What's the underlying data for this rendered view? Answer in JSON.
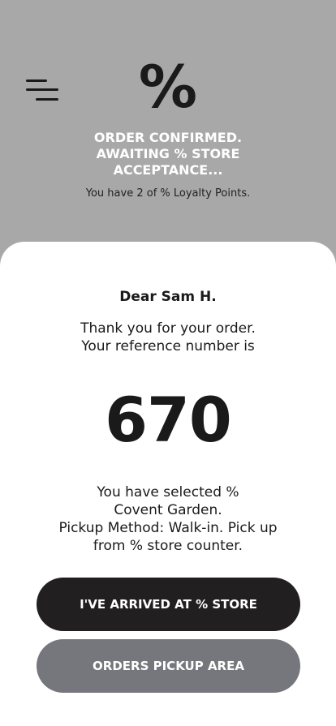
{
  "header": {
    "logo_text": "%",
    "status_lines": [
      "ORDER CONFIRMED.",
      "AWAITING % STORE",
      "ACCEPTANCE..."
    ],
    "loyalty_text": "You have 2 of % Loyalty Points."
  },
  "card": {
    "greeting": "Dear Sam H.",
    "thanks_lines": [
      "Thank you for your order.",
      "Your reference number is"
    ],
    "reference_number": "670",
    "store_lines": [
      "You have selected %",
      "Covent Garden.",
      "Pickup Method: Walk-in. Pick up",
      "from % store counter."
    ]
  },
  "buttons": {
    "arrived_label": "I'VE ARRIVED AT % STORE",
    "pickup_label": "ORDERS PICKUP AREA"
  },
  "colors": {
    "header_bg": "#a8a8a8",
    "primary_button": "#221f20",
    "secondary_button": "#76777c"
  }
}
